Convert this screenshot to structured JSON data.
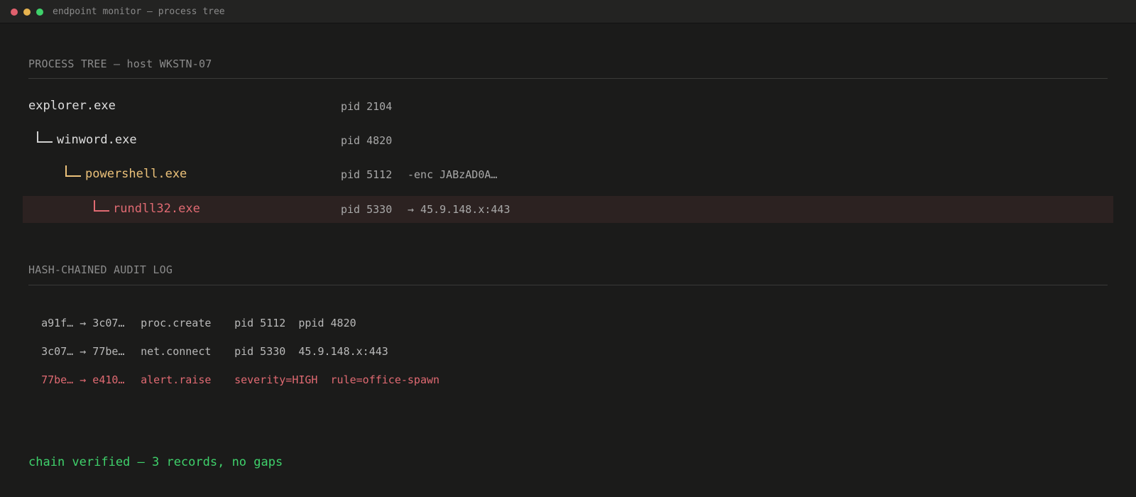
{
  "window": {
    "title": "endpoint monitor — process tree",
    "traffic_lights": [
      "close",
      "minimize",
      "maximize"
    ]
  },
  "process_tree": {
    "heading": "PROCESS TREE — host WKSTN-07",
    "rows": [
      {
        "name": "explorer.exe",
        "pid": "pid 2104",
        "extra": "",
        "color": "#dedede"
      },
      {
        "name": "winword.exe",
        "pid": "pid 4820",
        "extra": "",
        "color": "#dedede"
      },
      {
        "name": "powershell.exe",
        "pid": "pid 5112",
        "extra": "-enc JABzAD0A…",
        "color": "#ecc27a"
      },
      {
        "name": "rundll32.exe",
        "pid": "pid 5330",
        "extra": "→ 45.9.148.x:443",
        "color": "#e06a72"
      }
    ]
  },
  "audit_log": {
    "heading": "HASH-CHAINED AUDIT LOG",
    "entries": [
      {
        "hash": "a91f… → 3c07…",
        "event": "proc.create",
        "details": "pid 5112  ppid 4820"
      },
      {
        "hash": "3c07… → 77be…",
        "event": "net.connect",
        "details": "pid 5330  45.9.148.x:443"
      },
      {
        "hash": "77be… → e410…",
        "event": "alert.raise",
        "details": "severity=HIGH  rule=office-spawn"
      }
    ]
  },
  "status": {
    "verified": "chain verified — 3 records, no gaps"
  },
  "colors": {
    "background": "#1b1b1a",
    "alert": "#e06a72",
    "warning": "#ecc27a",
    "ok": "#3fd16b"
  }
}
